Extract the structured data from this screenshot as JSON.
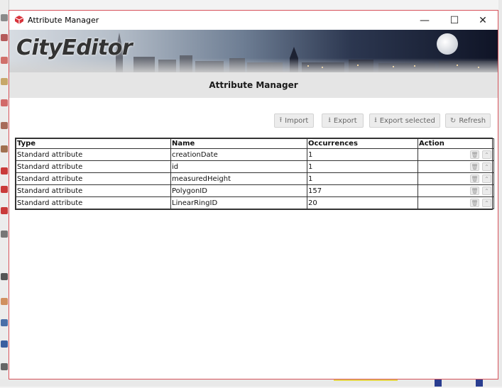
{
  "window": {
    "title": "Attribute Manager",
    "controls": {
      "minimize": "—",
      "maximize": "☐",
      "close": "✕"
    }
  },
  "banner": {
    "logo_text": "CityEditor"
  },
  "header": {
    "title": "Attribute Manager"
  },
  "toolbar": {
    "import_label": "Import",
    "export_label": "Export",
    "export_selected_label": "Export selected",
    "refresh_label": "Refresh",
    "import_icon": "⭱",
    "export_icon": "⭳",
    "export_selected_icon": "⭳",
    "refresh_icon": "↻"
  },
  "table": {
    "columns": [
      "Type",
      "Name",
      "Occurrences",
      "Action"
    ],
    "rows": [
      {
        "type": "Standard attribute",
        "name": "creationDate",
        "occurrences": "1"
      },
      {
        "type": "Standard attribute",
        "name": "id",
        "occurrences": "1"
      },
      {
        "type": "Standard attribute",
        "name": "measuredHeight",
        "occurrences": "1"
      },
      {
        "type": "Standard attribute",
        "name": "PolygonID",
        "occurrences": "157"
      },
      {
        "type": "Standard attribute",
        "name": "LinearRingID",
        "occurrences": "20"
      }
    ],
    "action_icons": {
      "delete": "🗑",
      "up": "⌃"
    }
  },
  "colors": {
    "window_border": "#d6525a",
    "app_icon": "#d8343c"
  }
}
